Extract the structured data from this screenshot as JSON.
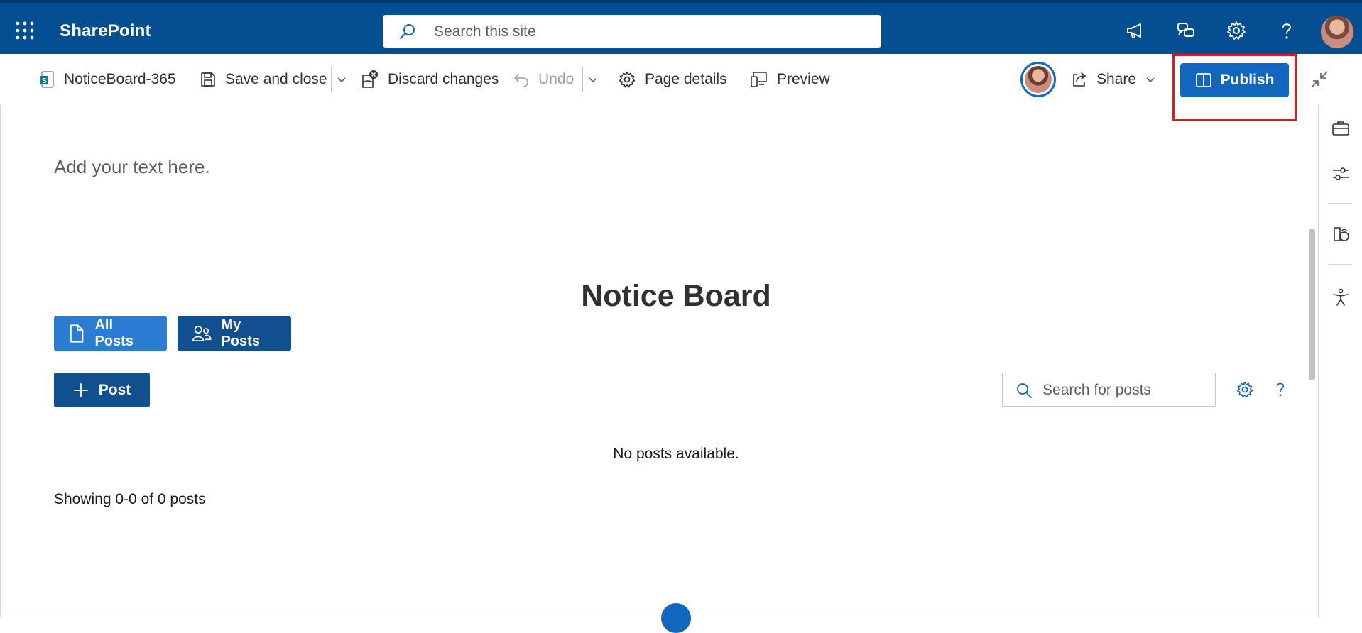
{
  "app": {
    "name": "SharePoint"
  },
  "header": {
    "search_placeholder": "Search this site"
  },
  "toolbar": {
    "page_name": "NoticeBoard-365",
    "save_close": "Save and close",
    "discard": "Discard changes",
    "undo": "Undo",
    "page_details": "Page details",
    "preview": "Preview",
    "share": "Share",
    "publish": "Publish"
  },
  "canvas": {
    "text_placeholder": "Add your text here.",
    "title": "Notice Board",
    "all_posts": "All Posts",
    "my_posts": "My Posts",
    "post_button": "Post",
    "search_placeholder": "Search for posts",
    "empty_message": "No posts available.",
    "pagination": "Showing 0-0 of 0 posts"
  },
  "colors": {
    "suite_bar": "#034f91",
    "primary": "#1366bd",
    "highlight": "#e3181d"
  },
  "icons": [
    "waffle-icon",
    "search-icon",
    "megaphone-icon",
    "chat-icon",
    "gear-icon",
    "help-icon",
    "save-icon",
    "discard-icon",
    "undo-icon",
    "chevron-down-icon",
    "settings-icon",
    "preview-icon",
    "share-icon",
    "book-icon",
    "collapse-icon",
    "toolbox-icon",
    "sliders-icon",
    "accessibility-icon",
    "plus-icon"
  ]
}
